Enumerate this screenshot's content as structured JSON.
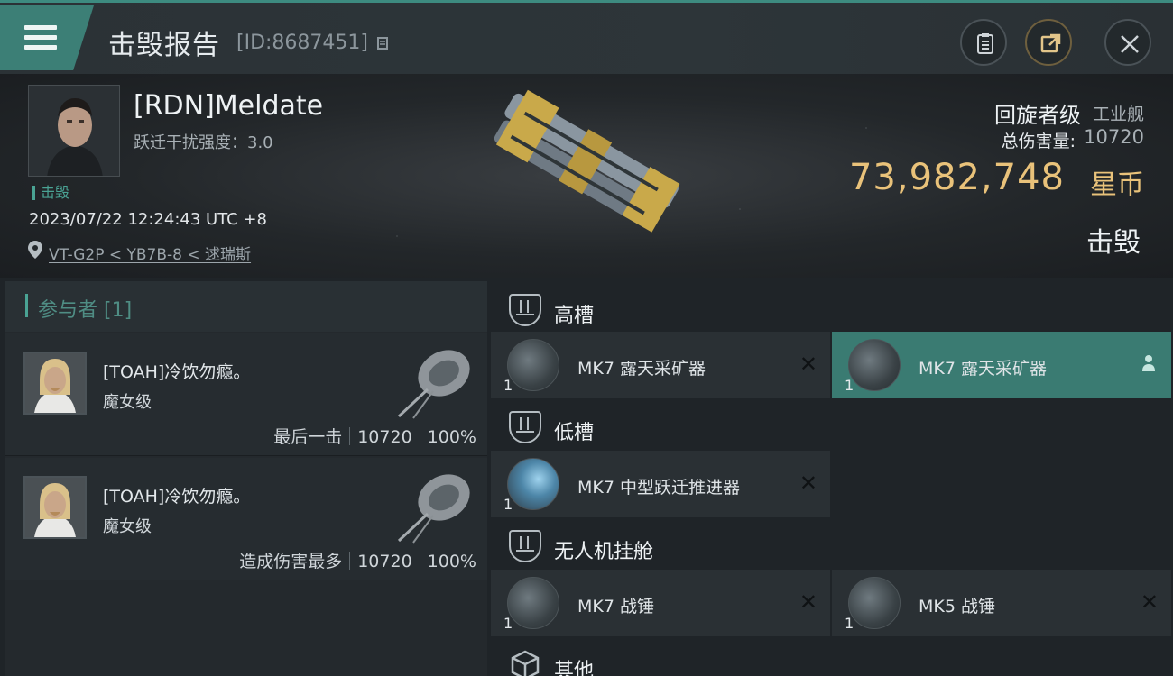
{
  "header": {
    "title": "击毁报告",
    "report_id": "[ID:8687451]",
    "icons": [
      "copy-icon",
      "report-icon",
      "share-icon",
      "close-icon"
    ]
  },
  "victim": {
    "name": "[RDN]Meldate",
    "warp_disrupt": "跃迁干扰强度：3.0",
    "status_tag": "击毁",
    "time": "2023/07/22 12:24:43 UTC +8",
    "location": "VT-G2P < YB7B-8 < 逑瑞斯",
    "ship_name": "回旋者级",
    "ship_class": "工业舰",
    "damage_label": "总伤害量:",
    "damage_value": "10720",
    "isk_value": "73,982,748",
    "isk_unit": "星币",
    "result": "击毁"
  },
  "participants": {
    "header": "参与者 [1]",
    "rows": [
      {
        "name": "[TOAH]冷饮勿瘾。",
        "ship": "魔女级",
        "role": "最后一击",
        "damage": "10720",
        "percent": "100%"
      },
      {
        "name": "[TOAH]冷饮勿瘾。",
        "ship": "魔女级",
        "role": "造成伤害最多",
        "damage": "10720",
        "percent": "100%"
      }
    ]
  },
  "fitting": {
    "high_label": "高槽",
    "low_label": "低槽",
    "drone_label": "无人机挂舱",
    "other_label": "其他",
    "modules": [
      {
        "name": "MK7 露天采矿器",
        "qty": "1",
        "state": "destroyed"
      },
      {
        "name": "MK7 露天采矿器",
        "qty": "1",
        "state": "dropped"
      },
      {
        "name": "MK7 中型跃迁推进器",
        "qty": "1",
        "state": "destroyed"
      },
      {
        "name": "MK7 战锤",
        "qty": "1",
        "state": "destroyed"
      },
      {
        "name": "MK5 战锤",
        "qty": "1",
        "state": "destroyed"
      }
    ],
    "destroyed_mark": "✕"
  },
  "colors": {
    "accent": "#3c7f76",
    "isk": "#e9c27a",
    "highlight": "#3a7b72"
  }
}
